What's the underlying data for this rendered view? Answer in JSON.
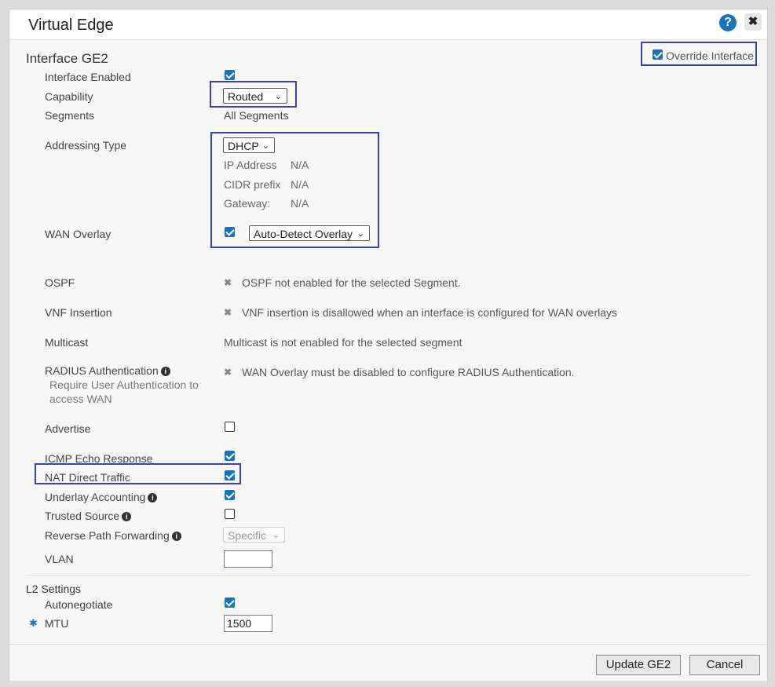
{
  "dialog": {
    "title": "Virtual Edge",
    "help_glyph": "?",
    "close_glyph": "✖"
  },
  "header": {
    "section_title": "Interface GE2",
    "override_label": "Override Interface",
    "override_checked": true
  },
  "fields": {
    "interface_enabled": {
      "label": "Interface Enabled",
      "checked": true
    },
    "capability": {
      "label": "Capability",
      "value": "Routed"
    },
    "segments": {
      "label": "Segments",
      "value": "All Segments"
    },
    "addressing_type": {
      "label": "Addressing Type",
      "value": "DHCP",
      "ip_label": "IP Address",
      "ip_value": "N/A",
      "cidr_label": "CIDR prefix",
      "cidr_value": "N/A",
      "gateway_label": "Gateway:",
      "gateway_value": "N/A"
    },
    "wan_overlay": {
      "label": "WAN Overlay",
      "checked": true,
      "value": "Auto-Detect Overlay"
    },
    "ospf": {
      "label": "OSPF",
      "status": "OSPF not enabled for the selected Segment."
    },
    "vnf": {
      "label": "VNF Insertion",
      "status": "VNF insertion is disallowed when an interface is configured for WAN overlays"
    },
    "multicast": {
      "label": "Multicast",
      "status": "Multicast is not enabled for the selected segment"
    },
    "radius": {
      "label": "RADIUS Authentication",
      "sub_line1": "Require User Authentication to",
      "sub_line2": "access WAN",
      "status": "WAN Overlay must be disabled to configure RADIUS Authentication."
    },
    "advertise": {
      "label": "Advertise",
      "checked": false
    },
    "icmp": {
      "label": "ICMP Echo Response",
      "checked": true
    },
    "nat": {
      "label": "NAT Direct Traffic",
      "checked": true
    },
    "underlay": {
      "label": "Underlay Accounting",
      "checked": true
    },
    "trusted": {
      "label": "Trusted Source",
      "checked": false
    },
    "rpf": {
      "label": "Reverse Path Forwarding",
      "value": "Specific"
    },
    "vlan": {
      "label": "VLAN",
      "value": ""
    }
  },
  "l2": {
    "section_title": "L2 Settings",
    "autonegotiate": {
      "label": "Autonegotiate",
      "checked": true
    },
    "mtu": {
      "label": "MTU",
      "value": "1500",
      "required_mark": "✱"
    }
  },
  "footer": {
    "update_label": "Update GE2",
    "cancel_label": "Cancel"
  },
  "icons": {
    "info": "i",
    "x": "✖",
    "chevron": "⌄"
  },
  "colors": {
    "accent": "#1a73b8",
    "highlight": "#3b3fb5"
  }
}
